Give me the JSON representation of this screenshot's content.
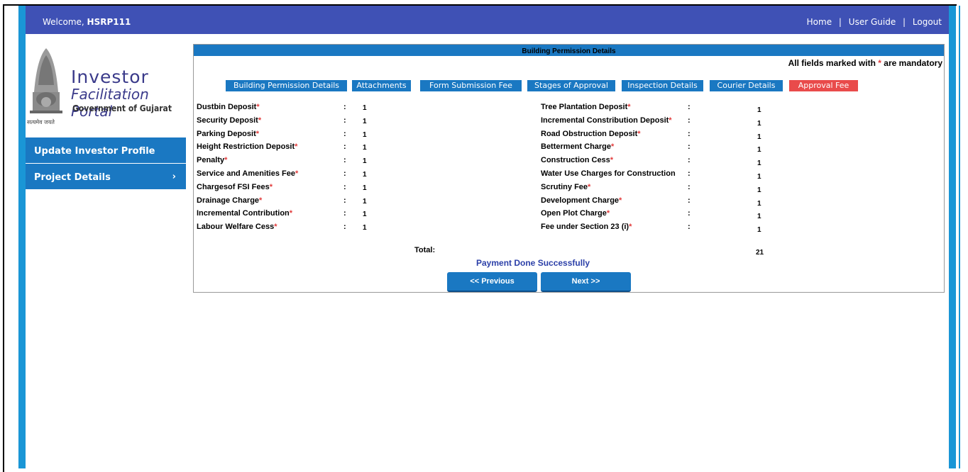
{
  "header": {
    "welcome_prefix": "Welcome,",
    "username": "HSRP111",
    "links": [
      "Home",
      "User Guide",
      "Logout"
    ],
    "separator": "|"
  },
  "logo": {
    "line1": "Investor",
    "line2": "Facilitation Portal",
    "line3": "Government of Gujarat",
    "motto": "सत्यमेव जयते"
  },
  "sidebar": {
    "items": [
      {
        "label": "Update Investor Profile"
      },
      {
        "label": "Project Details",
        "chevron": "›"
      }
    ]
  },
  "panel": {
    "title": "Building Permission Details",
    "mandatory_prefix": "All fields marked with",
    "mandatory_star": "*",
    "mandatory_suffix": "are mandatory",
    "tabs": [
      "Building Permission Details",
      "Attachments",
      "Form Submission Fee",
      "Stages of Approval",
      "Inspection Details",
      "Courier Details",
      "Approval Fee"
    ],
    "active_tab": "Approval Fee",
    "left_fields": [
      {
        "label": "Dustbin Deposit",
        "value": "1"
      },
      {
        "label": "Security Deposit",
        "value": "1"
      },
      {
        "label": "Parking Deposit",
        "value": "1"
      },
      {
        "label": "Height Restriction Deposit",
        "value": "1"
      },
      {
        "label": "Penalty",
        "value": "1"
      },
      {
        "label": "Service and Amenities Fee",
        "value": "1"
      },
      {
        "label": "Chargesof FSI Fees",
        "value": "1"
      },
      {
        "label": "Drainage Charge",
        "value": "1"
      },
      {
        "label": "Incremental Contribution",
        "value": "1"
      },
      {
        "label": "Labour Welfare Cess",
        "value": "1"
      }
    ],
    "right_fields": [
      {
        "label": "Tree Plantation Deposit",
        "value": "1"
      },
      {
        "label": "Incremental Constribution Deposit",
        "value": "1"
      },
      {
        "label": "Road Obstruction Deposit",
        "value": "1"
      },
      {
        "label": "Betterment Charge",
        "value": "1"
      },
      {
        "label": "Construction Cess",
        "value": "1"
      },
      {
        "label": "Water Use Charges for Construction",
        "value": "1"
      },
      {
        "label": "Scrutiny Fee",
        "value": "1"
      },
      {
        "label": "Development Charge",
        "value": "1"
      },
      {
        "label": "Open Plot Charge",
        "value": "1"
      },
      {
        "label": "Fee under Section 23 (i)",
        "value": "1"
      }
    ],
    "right_star_mask": [
      true,
      true,
      true,
      true,
      true,
      false,
      true,
      true,
      true,
      true
    ],
    "total_label": "Total:",
    "total_value": "21",
    "payment_status": "Payment Done Successfully",
    "prev_button": "<< Previous",
    "next_button": "Next >>"
  },
  "colors": {
    "topbar": "#3f51b5",
    "accent": "#1a78c2",
    "active_tab": "#e94b4b",
    "payment_text": "#2b3fa8"
  }
}
